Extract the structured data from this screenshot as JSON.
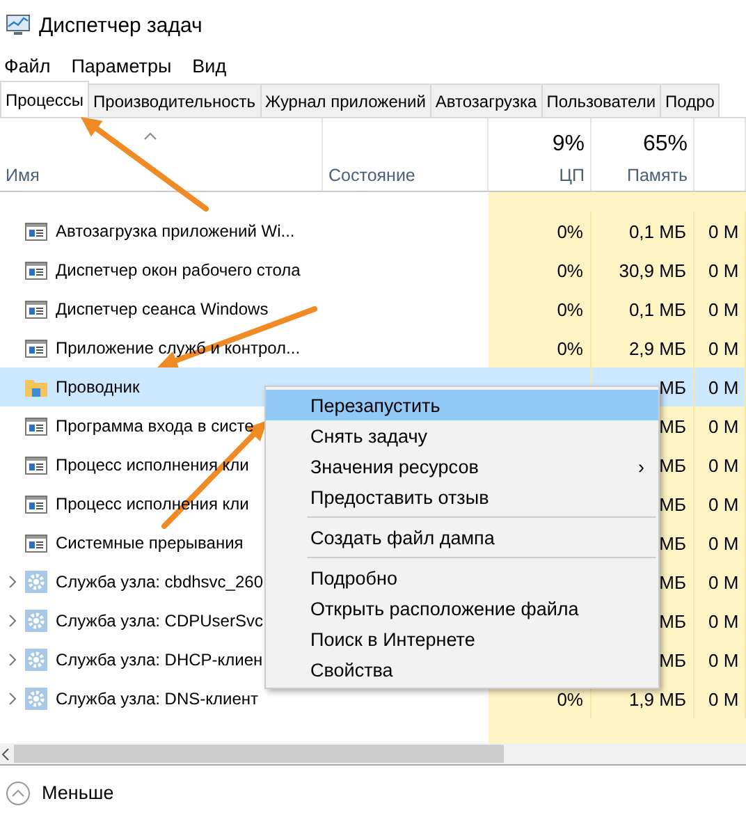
{
  "window": {
    "title": "Диспетчер задач"
  },
  "menu_bar": [
    "Файл",
    "Параметры",
    "Вид"
  ],
  "tabs": [
    {
      "label": "Процессы",
      "selected": true
    },
    {
      "label": "Производительность",
      "selected": false
    },
    {
      "label": "Журнал приложений",
      "selected": false
    },
    {
      "label": "Автозагрузка",
      "selected": false
    },
    {
      "label": "Пользователи",
      "selected": false
    },
    {
      "label": "Подро",
      "selected": false
    }
  ],
  "columns": [
    {
      "label": "Имя"
    },
    {
      "label": "Состояние"
    },
    {
      "label": "ЦП",
      "total": "9%"
    },
    {
      "label": "Память",
      "total": "65%"
    }
  ],
  "rows": [
    {
      "kind": "app",
      "name": "Автозагрузка приложений Wi...",
      "cpu": "0%",
      "memory": "0,1 МБ",
      "disk": "0 М",
      "selected": false
    },
    {
      "kind": "app",
      "name": "Диспетчер окон рабочего стола",
      "cpu": "0%",
      "memory": "30,9 МБ",
      "disk": "0 М",
      "selected": false
    },
    {
      "kind": "app",
      "name": "Диспетчер сеанса  Windows",
      "cpu": "0%",
      "memory": "0,1 МБ",
      "disk": "0 М",
      "selected": false
    },
    {
      "kind": "app",
      "name": "Приложение служб и контрол...",
      "cpu": "0%",
      "memory": "2,9 МБ",
      "disk": "0 М",
      "selected": false
    },
    {
      "kind": "folder",
      "name": "Проводник",
      "memory": "МБ",
      "disk": "0 М",
      "selected": true
    },
    {
      "kind": "app",
      "name": "Программа входа в систе",
      "memory": "МБ",
      "disk": "0 М",
      "selected": false
    },
    {
      "kind": "app",
      "name": "Процесс исполнения кли",
      "memory": "МБ",
      "disk": "0 М",
      "selected": false
    },
    {
      "kind": "app",
      "name": "Процесс исполнения кли",
      "memory": "МБ",
      "disk": "0 М",
      "selected": false
    },
    {
      "kind": "app",
      "name": "Системные прерывания",
      "memory": "МБ",
      "disk": "0 М",
      "selected": false
    },
    {
      "kind": "service",
      "name": "Служба узла: cbdhsvc_260",
      "memory": "МБ",
      "disk": "0 М",
      "selected": false
    },
    {
      "kind": "service",
      "name": "Служба узла: CDPUserSvc",
      "memory": "МБ",
      "disk": "0 М",
      "selected": false
    },
    {
      "kind": "service",
      "name": "Служба узла: DHCP-клиен",
      "memory": "МБ",
      "disk": "0 М",
      "selected": false
    },
    {
      "kind": "service",
      "name": "Служба узла: DNS-клиент",
      "cpu": "0%",
      "memory": "1,9 МБ",
      "disk": "0 М",
      "selected": false
    }
  ],
  "context_menu": [
    {
      "label": "Перезапустить",
      "selected": true,
      "submenu": false,
      "separator_before": false
    },
    {
      "label": "Снять задачу",
      "selected": false,
      "submenu": false,
      "separator_before": false
    },
    {
      "label": "Значения ресурсов",
      "selected": false,
      "submenu": true,
      "submenu_mark": "›",
      "separator_before": false
    },
    {
      "label": "Предоставить отзыв",
      "selected": false,
      "submenu": false,
      "separator_before": false
    },
    {
      "label": "Создать файл дампа",
      "selected": false,
      "submenu": false,
      "separator_before": true
    },
    {
      "label": "Подробно",
      "selected": false,
      "submenu": false,
      "separator_before": true
    },
    {
      "label": "Открыть расположение файла",
      "selected": false,
      "submenu": false,
      "separator_before": false
    },
    {
      "label": "Поиск в Интернете",
      "selected": false,
      "submenu": false,
      "separator_before": false
    },
    {
      "label": "Свойства",
      "selected": false,
      "submenu": false,
      "separator_before": false
    }
  ],
  "footer": {
    "label": "Меньше"
  }
}
